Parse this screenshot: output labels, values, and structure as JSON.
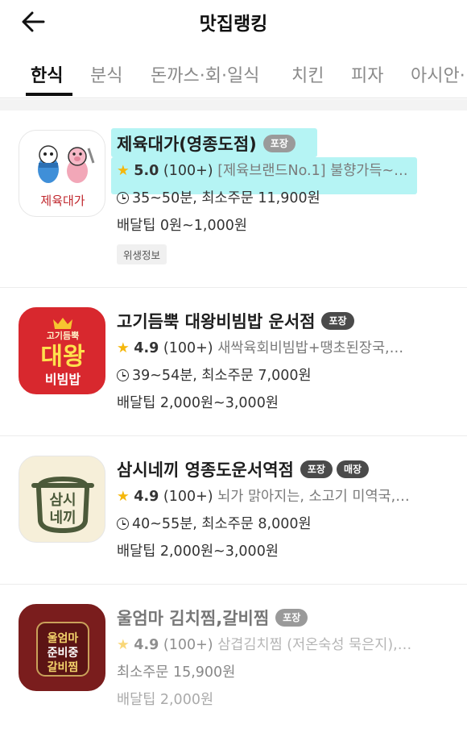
{
  "header": {
    "title": "맛집랭킹",
    "back_icon": "arrow-left-icon"
  },
  "tabs": [
    "한식",
    "분식",
    "돈까스·회·일식",
    "치킨",
    "피자",
    "아시안·"
  ],
  "active_tab": "한식",
  "colors": {
    "star": "#f5b70b",
    "highlight": "#78ebeb",
    "badge": "#4a4a4a"
  },
  "restaurants": [
    {
      "name": "제육대가(영종도점)",
      "badges": [
        "포장"
      ],
      "star": "★",
      "rating": "5.0",
      "reviews": "(100+)",
      "description": "[제육브랜드No.1] 불향가득~…",
      "delivery_time": "35~50분, 최소주문 11,900원",
      "delivery_tip": "배달팁 0원~1,000원",
      "tag": "위생정보",
      "logo_text": "제육대가"
    },
    {
      "name": "고기듬뿍 대왕비빔밥 운서점",
      "badges": [
        "포장"
      ],
      "star": "★",
      "rating": "4.9",
      "reviews": "(100+)",
      "description": "새싹육회비빔밥+땡초된장국,…",
      "delivery_time": "39~54분, 최소주문 7,000원",
      "delivery_tip": "배달팁 2,000원~3,000원",
      "logo_text": {
        "top": "고기듬뿍",
        "main": "대왕",
        "bottom": "비빔밥"
      }
    },
    {
      "name": "삼시네끼 영종도운서역점",
      "badges": [
        "포장",
        "매장"
      ],
      "star": "★",
      "rating": "4.9",
      "reviews": "(100+)",
      "description": "뇌가 맑아지는, 소고기 미역국,…",
      "delivery_time": "40~55분, 최소주문 8,000원",
      "delivery_tip": "배달팁 2,000원~3,000원",
      "logo_text": {
        "top": "삼시",
        "bottom": "네끼"
      }
    },
    {
      "name": "울엄마 김치찜,갈비찜",
      "badges": [
        "포장"
      ],
      "star": "★",
      "rating": "4.9",
      "reviews": "(100+)",
      "description": "삼겹김치찜 (저온숙성 묵은지),…",
      "min_order": "최소주문 15,900원",
      "delivery_tip": "배달팁 2,000원",
      "logo_text": {
        "line1": "울엄마",
        "line2": "준비중",
        "line3": "갈비찜"
      }
    }
  ]
}
